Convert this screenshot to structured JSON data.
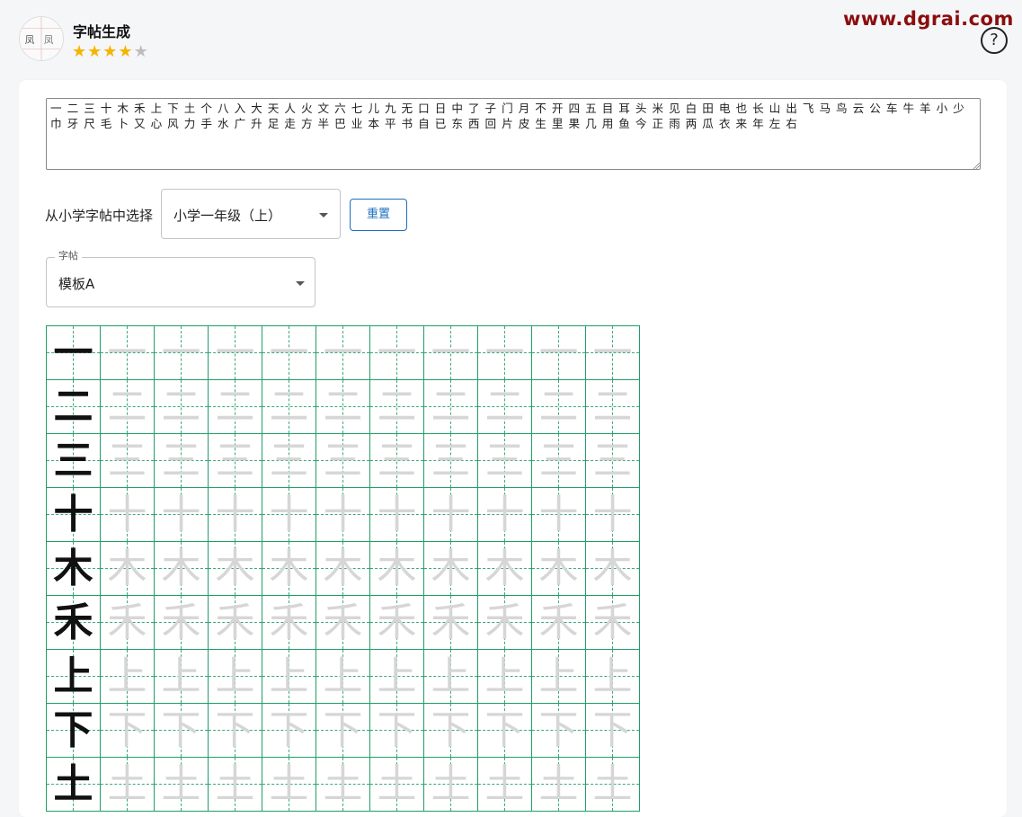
{
  "header": {
    "title": "字帖生成",
    "rating": {
      "filled": 4,
      "total": 5
    },
    "watermark": "www.dgrai.com",
    "help_label": "?",
    "logo_icon": "calligraphy-logo-icon"
  },
  "form": {
    "characters_text": "一 二 三 十 木 禾 上 下 土 个 八 入 大 天 人 火 文 六 七 儿 九 无 口 日 中 了 子 门 月 不 开 四 五 目 耳 头 米 见 白 田 电 也 长 山 出 飞 马 鸟 云 公 车 牛 羊 小 少 巾 牙 尺 毛 卜 又 心 风 力 手 水 广 升 足 走 方 半 巴 业 本 平 书 自 已 东 西 回 片 皮 生 里 果 几 用 鱼 今 正 雨 两 瓜 衣 来 年 左 右",
    "select_label": "从小学字帖中选择",
    "grade_value": "小学一年级（上）",
    "reset_label": "重置",
    "template_legend": "字帖",
    "template_value": "模板A"
  },
  "grid": {
    "columns": 11,
    "rows": [
      "一",
      "二",
      "三",
      "十",
      "木",
      "禾",
      "上",
      "下",
      "土"
    ]
  },
  "colors": {
    "grid_line": "#1f9e66",
    "trace_char": "#d6d6d6",
    "accent": "#1e6fc0",
    "watermark": "#8b0e0e",
    "star": "#f6b400"
  }
}
